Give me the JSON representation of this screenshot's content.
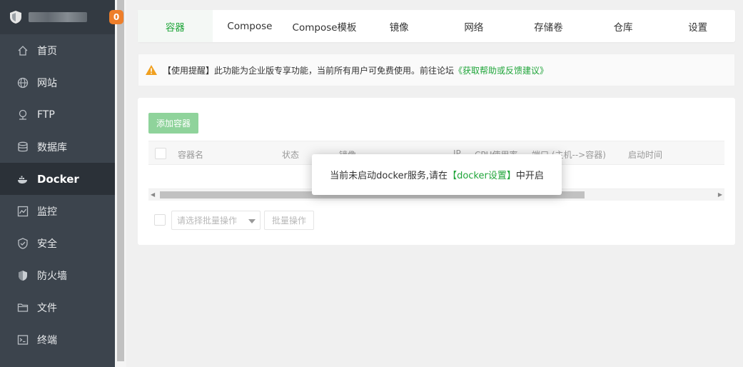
{
  "sidebar": {
    "badge": "0",
    "items": [
      {
        "label": "首页",
        "icon": "home-icon"
      },
      {
        "label": "网站",
        "icon": "globe-icon"
      },
      {
        "label": "FTP",
        "icon": "ftp-icon"
      },
      {
        "label": "数据库",
        "icon": "database-icon"
      },
      {
        "label": "Docker",
        "icon": "docker-icon"
      },
      {
        "label": "监控",
        "icon": "monitor-icon"
      },
      {
        "label": "安全",
        "icon": "shield-check-icon"
      },
      {
        "label": "防火墙",
        "icon": "firewall-icon"
      },
      {
        "label": "文件",
        "icon": "folder-icon"
      },
      {
        "label": "终端",
        "icon": "terminal-icon"
      }
    ],
    "active": "Docker"
  },
  "tabs": [
    "容器",
    "Compose",
    "Compose模板",
    "镜像",
    "网络",
    "存储卷",
    "仓库",
    "设置"
  ],
  "active_tab": "容器",
  "notice": {
    "text": "【使用提醒】此功能为企业版专享功能，当前所有用户可免费使用。前往论坛",
    "link": "《获取帮助或反馈建议》"
  },
  "main": {
    "add_button": "添加容器",
    "columns": [
      "容器名",
      "状态",
      "镜像",
      "IP",
      "CPU使用率",
      "端口 (主机-->容器)",
      "启动时间"
    ],
    "batch_select_placeholder": "请选择批量操作",
    "batch_button": "批量操作"
  },
  "popup": {
    "text_before": "当前未启动docker服务,请在",
    "link": "【docker设置】",
    "text_after": "中开启"
  },
  "colors": {
    "accent": "#20a53a",
    "sidebar_bg": "#3c444d",
    "badge": "#ee7e2a"
  }
}
